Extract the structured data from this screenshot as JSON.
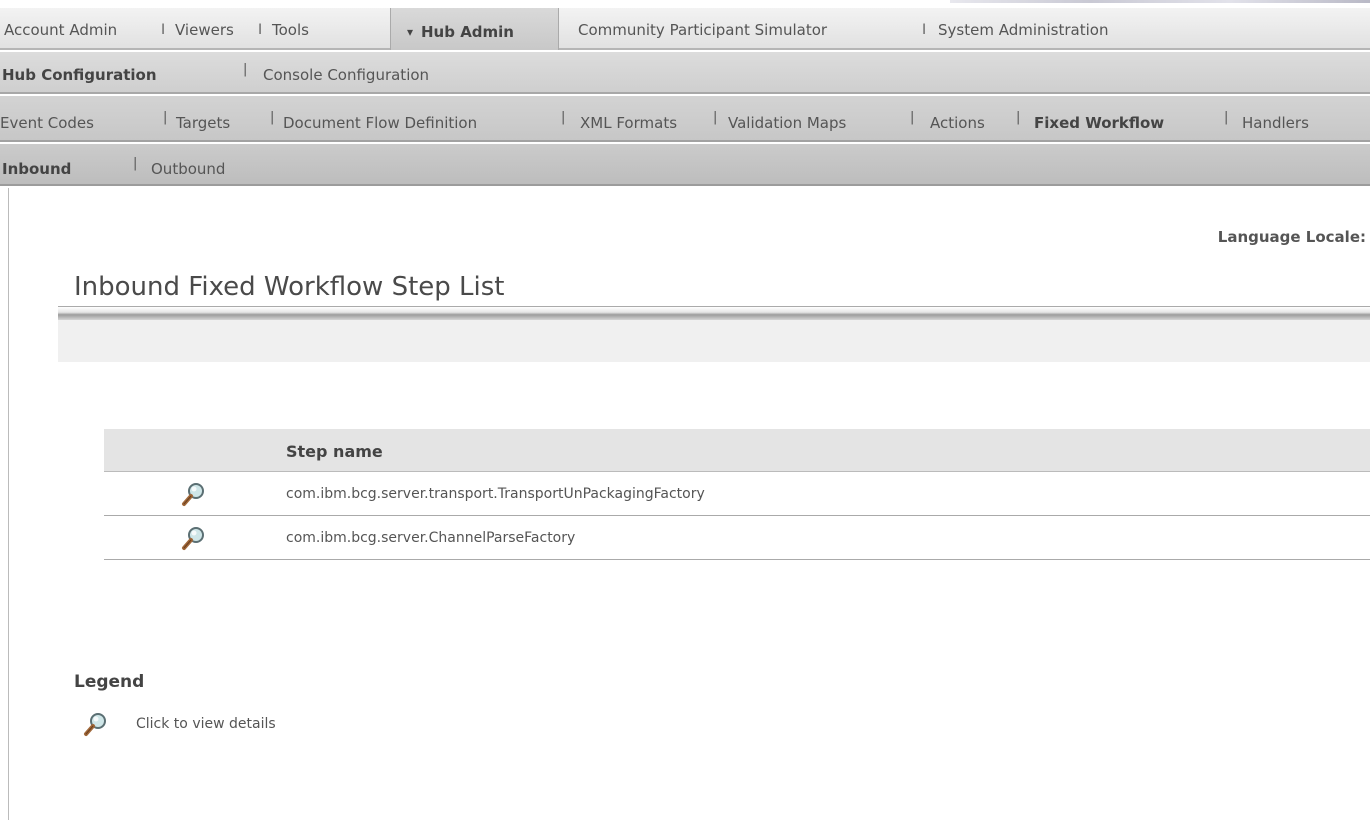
{
  "top_nav": {
    "items": [
      "Account Admin",
      "Viewers",
      "Tools"
    ],
    "active": "Hub Admin",
    "active_glyph": "▾",
    "more_items": [
      "Community Participant Simulator",
      "System Administration"
    ]
  },
  "sub_nav": {
    "items": [
      "Hub Configuration",
      "Console Configuration"
    ]
  },
  "config_nav": {
    "items": [
      "Event Codes",
      "Targets",
      "Document Flow Definition",
      "XML Formats",
      "Validation Maps",
      "Actions",
      "Fixed Workflow",
      "Handlers"
    ]
  },
  "direction_nav": {
    "items": [
      "Inbound",
      "Outbound"
    ]
  },
  "language_locale_label": "Language Locale:",
  "page_title": "Inbound Fixed Workflow Step List",
  "table": {
    "header": "Step name",
    "rows": [
      {
        "name": "com.ibm.bcg.server.transport.TransportUnPackagingFactory",
        "icon": "magnifier-icon"
      },
      {
        "name": "com.ibm.bcg.server.ChannelParseFactory",
        "icon": "magnifier-icon"
      }
    ]
  },
  "legend": {
    "title": "Legend",
    "items": [
      {
        "icon": "magnifier-icon",
        "text": "Click to view details"
      }
    ]
  },
  "separator": "I",
  "separator_small": "|"
}
